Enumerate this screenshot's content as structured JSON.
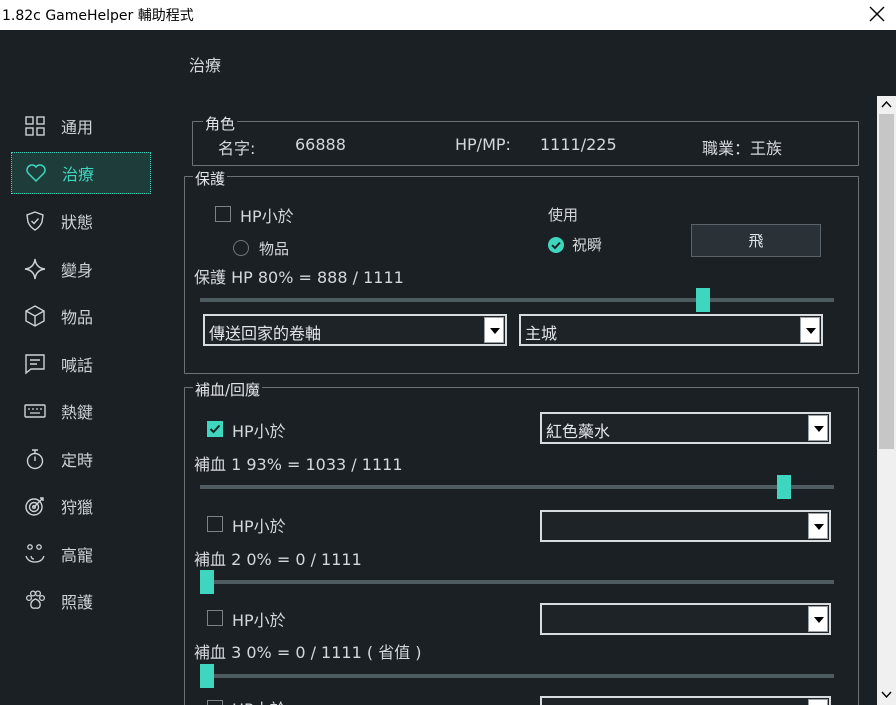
{
  "window": {
    "title": "1.82c GameHelper 輔助程式"
  },
  "sidebar": {
    "items": [
      {
        "label": "通用",
        "icon": "grid-icon"
      },
      {
        "label": "治療",
        "icon": "heart-icon"
      },
      {
        "label": "狀態",
        "icon": "shield-icon"
      },
      {
        "label": "變身",
        "icon": "sparkle-icon"
      },
      {
        "label": "物品",
        "icon": "cube-icon"
      },
      {
        "label": "喊話",
        "icon": "message-icon"
      },
      {
        "label": "熱鍵",
        "icon": "keyboard-icon"
      },
      {
        "label": "定時",
        "icon": "timer-icon"
      },
      {
        "label": "狩獵",
        "icon": "target-icon"
      },
      {
        "label": "高寵",
        "icon": "bubbles-icon"
      },
      {
        "label": "照護",
        "icon": "paw-icon"
      }
    ],
    "active": "治療"
  },
  "page": {
    "title": "治療"
  },
  "character": {
    "group_label": "角色",
    "name_label": "名字:",
    "name_value": "66888",
    "hpmp_label": "HP/MP:",
    "hpmp_value": "1111/225",
    "job_text": "職業：王族"
  },
  "protect": {
    "group_label": "保護",
    "hp_check_label": "HP小於",
    "hp_checked": false,
    "use_label": "使用",
    "item_option": "物品",
    "bless_option": "祝瞬",
    "fly_button": "飛",
    "slider_label": "保護 HP  80% = 888 / 1111",
    "slider_percent": 80,
    "scroll_select": "傳送回家的卷軸",
    "town_select": "主城"
  },
  "heal": {
    "group_label": "補血/回魔",
    "entries": [
      {
        "check_label": "HP小於",
        "checked": true,
        "select": "紅色藥水",
        "slider_label": "補血 1  93% = 1033 / 1111",
        "percent": 93
      },
      {
        "check_label": "HP小於",
        "checked": false,
        "select": "",
        "slider_label": "補血 2  0% = 0 / 1111",
        "percent": 0
      },
      {
        "check_label": "HP小於",
        "checked": false,
        "select": "",
        "slider_label": "補血 3  0% = 0 / 1111 ( 省值 )",
        "percent": 0
      },
      {
        "check_label": "HP小於",
        "checked": false,
        "select": ""
      }
    ]
  },
  "colors": {
    "accent": "#3fd6bf",
    "background": "#1b2025"
  }
}
